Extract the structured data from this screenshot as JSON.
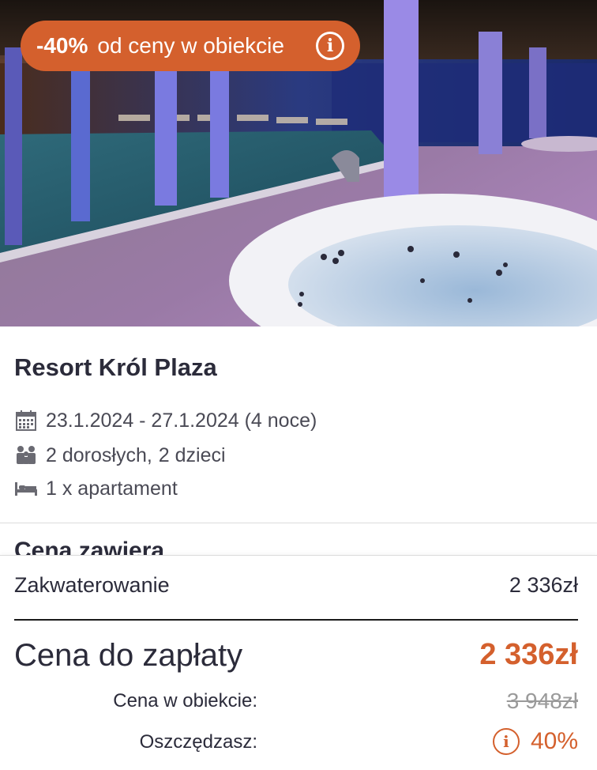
{
  "hero": {
    "badge_percent": "-40%",
    "badge_text": "od ceny w obiekcie",
    "badge_icon": "info-icon"
  },
  "hotel": {
    "name": "Resort Król Plaza",
    "dates": "23.1.2024 - 27.1.2024 (4 noce)",
    "guests_adults": "2 dorosłych,",
    "guests_children": "2 dzieci",
    "room": "1 x apartament",
    "icons": [
      "calendar-icon",
      "people-icon",
      "bed-icon"
    ]
  },
  "section": {
    "heading": "Cena zawiera"
  },
  "price": {
    "accommodation_label": "Zakwaterowanie",
    "accommodation_value": "2 336zł",
    "total_label": "Cena do zapłaty",
    "total_value": "2 336zł",
    "object_price_label": "Cena w obiekcie:",
    "object_price_value": "3 948zł",
    "savings_label": "Oszczędzasz:",
    "savings_value": "40%"
  },
  "colors": {
    "accent": "#d4602d",
    "text": "#2b2b3a",
    "muted": "#9a9a9a"
  }
}
